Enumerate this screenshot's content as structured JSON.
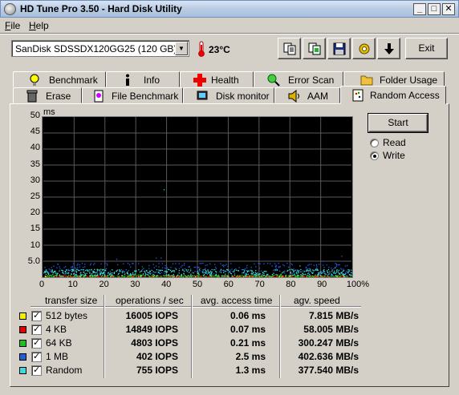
{
  "window": {
    "title": "HD Tune Pro 3.50 - Hard Disk Utility"
  },
  "menu": {
    "file": "File",
    "help": "Help"
  },
  "toolbar": {
    "drive": "SanDisk SDSSDX120GG25 (120 GB)",
    "temperature": "23°C",
    "exit_label": "Exit"
  },
  "tabs_top": [
    "Benchmark",
    "Info",
    "Health",
    "Error Scan",
    "Folder Usage"
  ],
  "tabs_bottom": [
    "Erase",
    "File Benchmark",
    "Disk monitor",
    "AAM",
    "Random Access"
  ],
  "controls": {
    "start_label": "Start",
    "read_label": "Read",
    "write_label": "Write",
    "selected_mode": "Write"
  },
  "chart_data": {
    "type": "scatter",
    "ylabel": "ms",
    "ylim": [
      0,
      50
    ],
    "yticks": [
      "50",
      "45",
      "40",
      "35",
      "30",
      "25",
      "20",
      "15",
      "10",
      "5.0"
    ],
    "xticks": [
      "0",
      "10",
      "20",
      "30",
      "40",
      "50",
      "60",
      "70",
      "80",
      "90",
      "100%"
    ],
    "xlim": [
      0,
      100
    ],
    "grid": true,
    "series": [
      {
        "color": "#e8e800",
        "access_ms": 0.06
      },
      {
        "color": "#e00000",
        "access_ms": 0.07
      },
      {
        "color": "#00c000",
        "access_ms": 0.21
      },
      {
        "color": "#2060ff",
        "access_ms": 2.5
      },
      {
        "color": "#40e0e0",
        "access_ms": 1.3
      }
    ]
  },
  "results": {
    "headers": [
      "transfer size",
      "operations / sec",
      "avg. access time",
      "agv. speed"
    ],
    "rows": [
      {
        "color": "#f0f000",
        "size": "512 bytes",
        "ops": "16005 IOPS",
        "access": "0.06 ms",
        "speed": "7.815 MB/s"
      },
      {
        "color": "#e00000",
        "size": "4 KB",
        "ops": "14849 IOPS",
        "access": "0.07 ms",
        "speed": "58.005 MB/s"
      },
      {
        "color": "#20c020",
        "size": "64 KB",
        "ops": "4803 IOPS",
        "access": "0.21 ms",
        "speed": "300.247 MB/s"
      },
      {
        "color": "#2060d0",
        "size": "1 MB",
        "ops": "402 IOPS",
        "access": "2.5 ms",
        "speed": "402.636 MB/s"
      },
      {
        "color": "#40d8d8",
        "size": "Random",
        "ops": "755 IOPS",
        "access": "1.3 ms",
        "speed": "377.540 MB/s"
      }
    ]
  }
}
